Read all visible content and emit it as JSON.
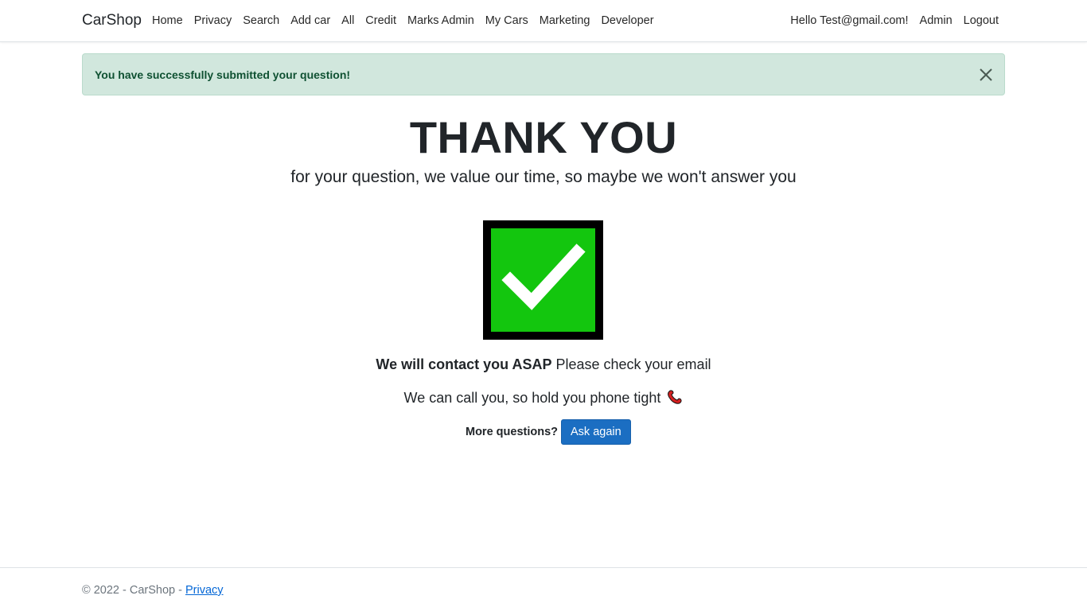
{
  "navbar": {
    "brand": "CarShop",
    "left_links": [
      "Home",
      "Privacy",
      "Search",
      "Add car",
      "All",
      "Credit",
      "Marks Admin",
      "My Cars",
      "Marketing",
      "Developer"
    ],
    "greeting": "Hello Test@gmail.com!",
    "admin": "Admin",
    "logout": "Logout"
  },
  "alert": {
    "message": "You have successfully submitted your question!",
    "close_icon": "close-icon"
  },
  "main": {
    "title": "THANK YOU",
    "subtitle": "for your question, we value our time, so maybe we won't answer you",
    "check_icon": "checkmark-icon",
    "contact_bold": "We will contact you ASAP",
    "contact_rest": " Please check your email",
    "call_text": "We can call you, so hold you phone tight",
    "phone_icon": "phone-icon",
    "more_label": "More questions?",
    "ask_button": "Ask again"
  },
  "footer": {
    "copyright": "© 2022 - CarShop - ",
    "privacy_link": "Privacy"
  },
  "colors": {
    "alert_bg": "#d1e7dd",
    "alert_text": "#0f5132",
    "check_green": "#13c60e",
    "button_blue": "#1b6ec2"
  }
}
